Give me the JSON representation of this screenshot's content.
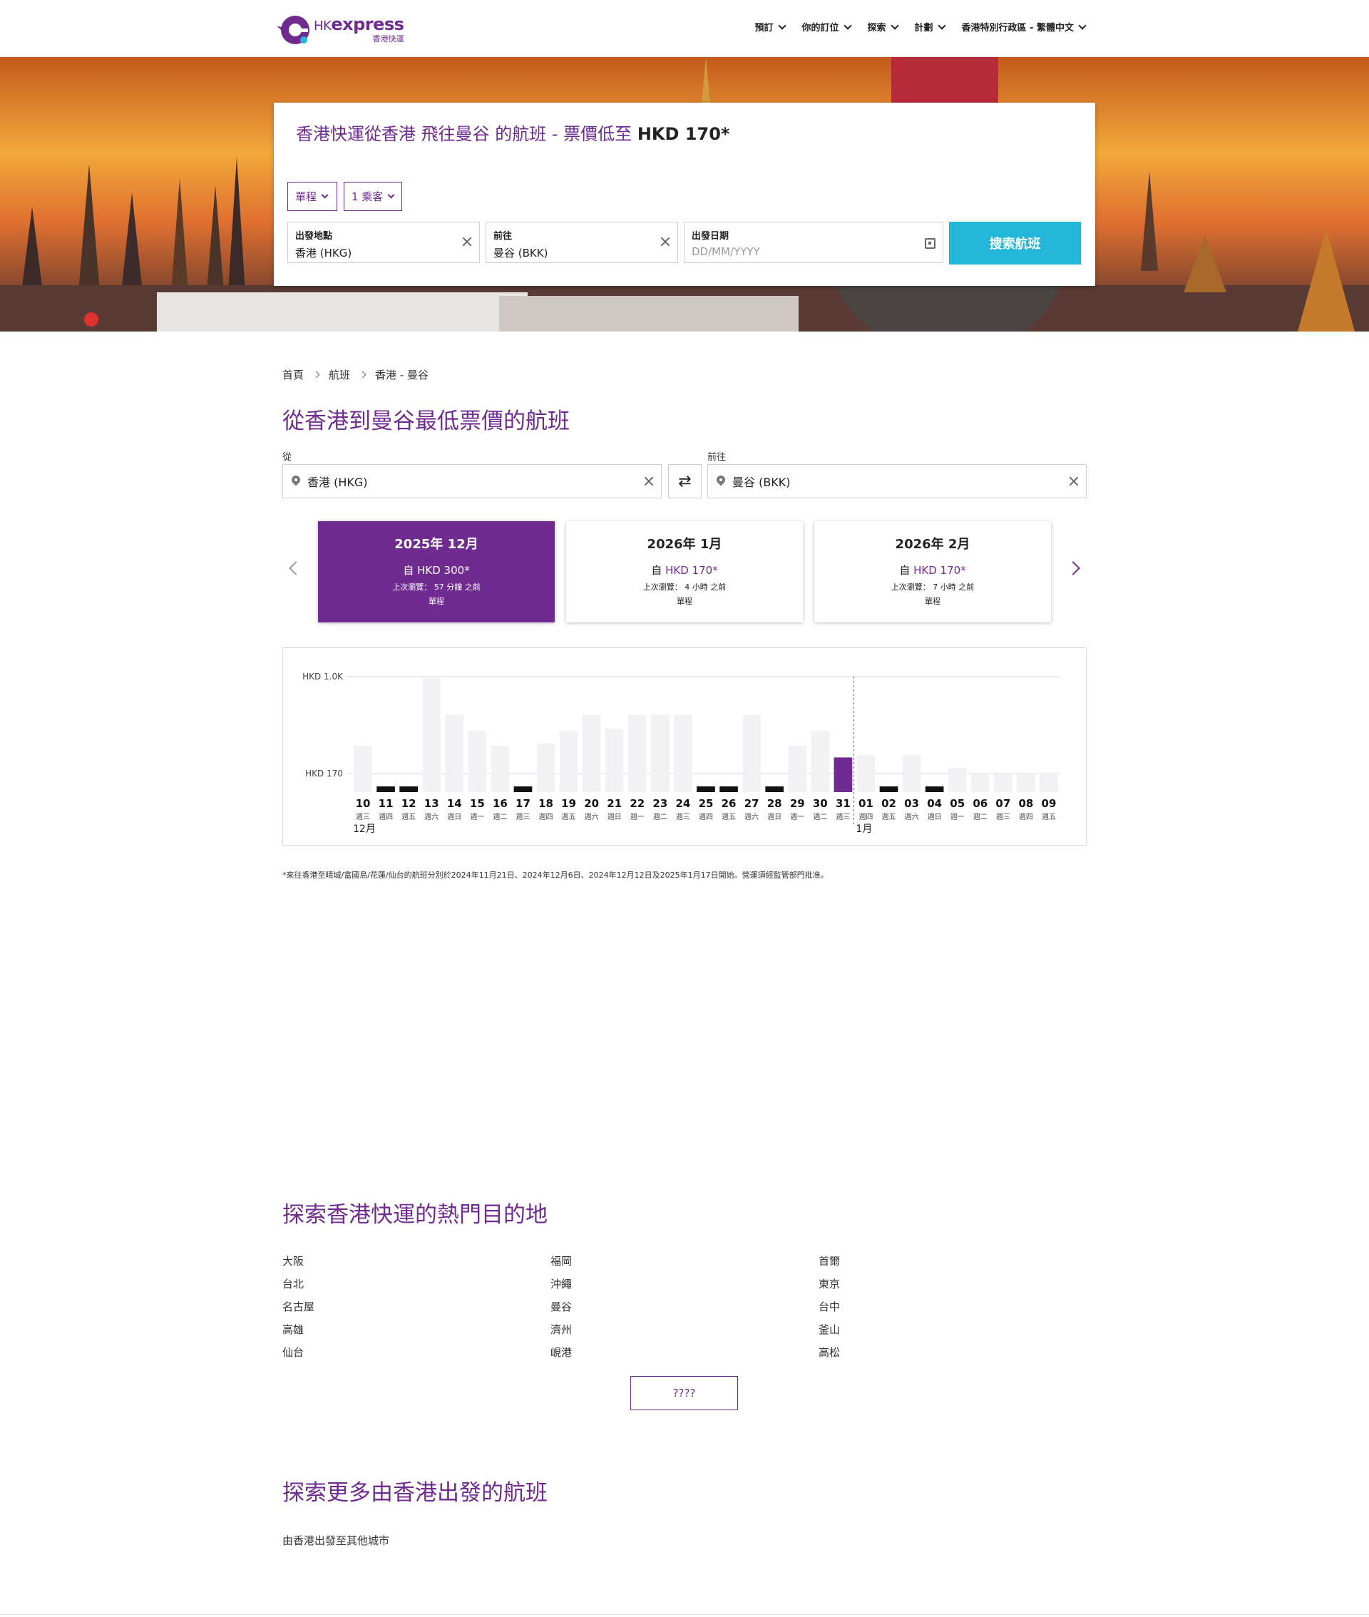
{
  "brand": {
    "name_hk": "HK",
    "name_express": "express",
    "subtitle": "香港快運",
    "color": "#702b91"
  },
  "nav": [
    {
      "label": "預訂"
    },
    {
      "label": "你的訂位"
    },
    {
      "label": "探索"
    },
    {
      "label": "計劃"
    },
    {
      "label": "香港特別行政區 - 繁體中文"
    }
  ],
  "search": {
    "headline": "香港快運從香港 飛往曼谷 的航班 - 票價低至",
    "headline_price": "HKD 170*",
    "trip_type": "單程",
    "passengers": "1 乘客",
    "origin_label": "出發地點",
    "origin_value": "香港 (HKG)",
    "destination_label": "前往",
    "destination_value": "曼谷 (BKK)",
    "date_label": "出發日期",
    "date_placeholder": "DD/MM/YYYY",
    "button": "搜索航班",
    "button_color": "#22b7d8"
  },
  "breadcrumb": [
    "首頁",
    "航班",
    "香港 - 曼谷"
  ],
  "page_title": "從香港到曼谷最低票價的航班",
  "route": {
    "from_label": "從",
    "from_value": "香港 (HKG)",
    "to_label": "前往",
    "to_value": "曼谷 (BKK)",
    "swap_glyph": "⇄"
  },
  "months": [
    {
      "title": "2025年 12月",
      "price_prefix": "自",
      "price": "HKD 300",
      "asterisk": "*",
      "meta": "上次瀏覽： 57 分鐘 之前",
      "trip": "單程",
      "active": true
    },
    {
      "title": "2026年 1月",
      "price_prefix": "自",
      "price": "HKD 170",
      "asterisk": "*",
      "meta": "上次瀏覽： 4 小時 之前",
      "trip": "單程",
      "active": false
    },
    {
      "title": "2026年 2月",
      "price_prefix": "自",
      "price": "HKD 170",
      "asterisk": "*",
      "meta": "上次瀏覽： 7 小時 之前",
      "trip": "單程",
      "active": false
    }
  ],
  "chart_data": {
    "type": "bar",
    "y_tick_labels": [
      "HKD 1.0K",
      "HKD 170"
    ],
    "ylim": [
      0,
      1000
    ],
    "days": [
      "10",
      "11",
      "12",
      "13",
      "14",
      "15",
      "16",
      "17",
      "18",
      "19",
      "20",
      "21",
      "22",
      "23",
      "24",
      "25",
      "26",
      "27",
      "28",
      "29",
      "30",
      "31",
      "01",
      "02",
      "03",
      "04",
      "05",
      "06",
      "07",
      "08",
      "09"
    ],
    "weekdays": [
      "週三",
      "週四",
      "週五",
      "週六",
      "週日",
      "週一",
      "週二",
      "週三",
      "週四",
      "週五",
      "週六",
      "週日",
      "週一",
      "週二",
      "週三",
      "週四",
      "週五",
      "週六",
      "週日",
      "週一",
      "週二",
      "週三",
      "週四",
      "週五",
      "週六",
      "週日",
      "週一",
      "週二",
      "週三",
      "週四",
      "週五"
    ],
    "values": [
      400,
      40,
      40,
      1000,
      670,
      530,
      400,
      40,
      420,
      530,
      670,
      550,
      670,
      670,
      670,
      40,
      40,
      670,
      40,
      400,
      530,
      300,
      320,
      40,
      320,
      40,
      210,
      170,
      170,
      170,
      170
    ],
    "available": [
      false,
      true,
      true,
      false,
      false,
      false,
      false,
      true,
      false,
      false,
      false,
      false,
      false,
      false,
      false,
      true,
      true,
      false,
      true,
      false,
      false,
      true,
      false,
      true,
      false,
      true,
      false,
      false,
      false,
      false,
      false
    ],
    "selected_index": 21,
    "month_labels": [
      {
        "label": "12月",
        "start_index": 0
      },
      {
        "label": "1月",
        "start_index": 22
      }
    ],
    "colors": {
      "bar": "#f2f2f4",
      "available": "#111111",
      "selected": "#702b91"
    }
  },
  "footnote": "*來往香港至晴城/富國島/花蓮/仙台的航班分別於2024年11月21日、2024年12月6日、2024年12月12日及2025年1月17日開始。營運須經監管部門批准。",
  "popular": {
    "title": "探索香港快運的熱門目的地",
    "columns": [
      [
        "大阪",
        "台北",
        "名古屋",
        "高雄",
        "仙台"
      ],
      [
        "福岡",
        "沖繩",
        "曼谷",
        "濟州",
        "峴港"
      ],
      [
        "首爾",
        "東京",
        "台中",
        "釜山",
        "高松"
      ]
    ],
    "more_button": "????"
  },
  "more_flights": {
    "title": "探索更多由香港出發的航班",
    "subtitle": "由香港出發至其他城市"
  }
}
